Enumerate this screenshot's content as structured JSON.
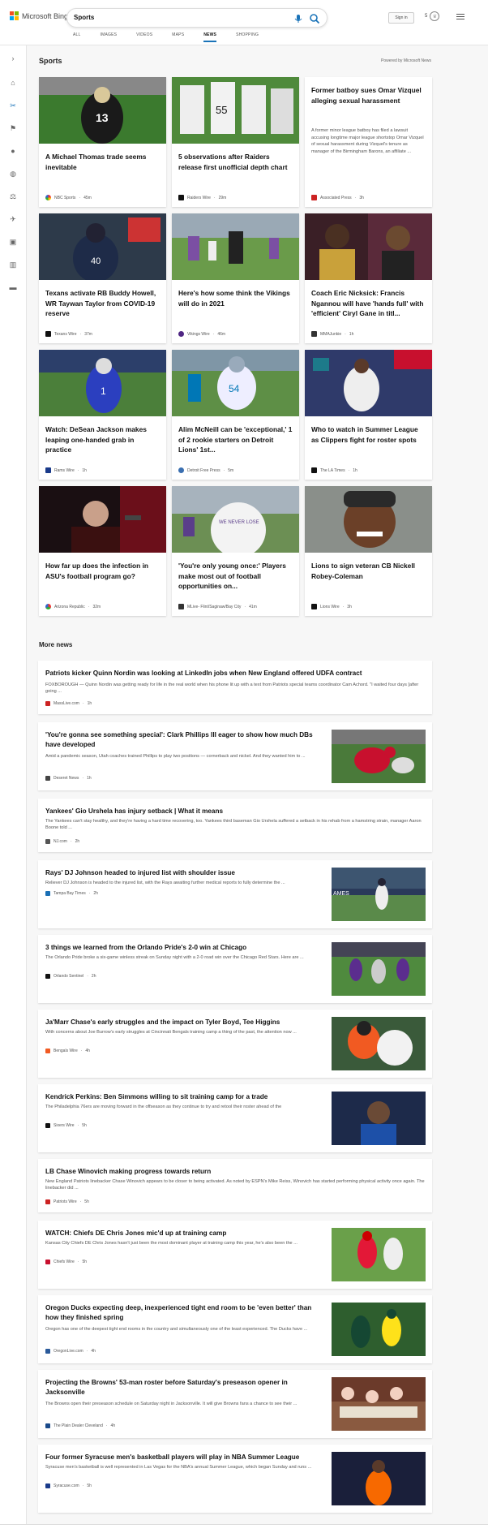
{
  "header": {
    "brand": "Microsoft Bing",
    "query": "Sports",
    "signin": "Sign in",
    "rewards_count": "5",
    "tabs": [
      "ALL",
      "IMAGES",
      "VIDEOS",
      "MAPS",
      "NEWS",
      "SHOPPING"
    ],
    "active_tab": "NEWS"
  },
  "section": {
    "title": "Sports",
    "powered": "Powered by Microsoft News"
  },
  "cards": [
    {
      "title": "A Michael Thomas trade seems inevitable",
      "source": "NBC Sports",
      "age": "45m"
    },
    {
      "title": "5 observations after Raiders release first unofficial depth chart",
      "source": "Raiders Wire",
      "age": "29m"
    },
    {
      "title": "Former batboy sues Omar Vizquel alleging sexual harassment",
      "desc": "A former minor league batboy has filed a lawsuit accusing longtime major league shortstop Omar Vizquel of sexual harassment during Vizquel's tenure as manager of the Birmingham Barons, an affiliate ...",
      "source": "Associated Press",
      "age": "3h"
    },
    {
      "title": "Texans activate RB Buddy Howell, WR Taywan Taylor from COVID-19 reserve",
      "source": "Texans Wire",
      "age": "37m"
    },
    {
      "title": "Here's how some think the Vikings will do in 2021",
      "source": "Vikings Wire",
      "age": "46m"
    },
    {
      "title": "Coach Eric Nicksick: Francis Ngannou will have 'hands full' with 'efficient' Ciryl Gane in titl...",
      "source": "MMAJunkie",
      "age": "1h"
    },
    {
      "title": "Watch: DeSean Jackson makes leaping one-handed grab in practice",
      "source": "Rams Wire",
      "age": "1h"
    },
    {
      "title": "Alim McNeill can be 'exceptional,' 1 of 2 rookie starters on Detroit Lions' 1st...",
      "source": "Detroit Free Press",
      "age": "5m"
    },
    {
      "title": "Who to watch in Summer League as Clippers fight for roster spots",
      "source": "The LA Times",
      "age": "1h"
    },
    {
      "title": "How far up does the infection in ASU's football program go?",
      "source": "Arizona Republic",
      "age": "32m"
    },
    {
      "title": "'You're only young once:' Players make most out of football opportunities on...",
      "source": "MLive- Flint/Saginaw/Bay City",
      "age": "41m"
    },
    {
      "title": "Lions to sign veteran CB Nickell Robey-Coleman",
      "source": "Lions Wire",
      "age": "3h"
    }
  ],
  "more_news_title": "More news",
  "news": [
    {
      "title": "Patriots kicker Quinn Nordin was looking at LinkedIn jobs when New England offered UDFA contract",
      "desc": "FOXBOROUGH — Quinn Nordin was getting ready for life in the real world when his phone lit up with a text from Patriots special teams coordinator Cam Achord. \"I waited four days [after going ...",
      "source": "MassLive.com",
      "age": "1h"
    },
    {
      "title": "'You're gonna see something special': Clark Phillips III eager to show how much DBs have developed",
      "desc": "Amid a pandemic season, Utah coaches trained Phillips to play two positions — cornerback and nickel. And they wanted him to ...",
      "source": "Deseret News",
      "age": "1h"
    },
    {
      "title": "Yankees' Gio Urshela has injury setback | What it means",
      "desc": "The Yankees can't stay healthy, and they're having a hard time recovering, too. Yankees third baseman Gio Urshela suffered a setback in his rehab from a hamstring strain, manager Aaron Boone told ...",
      "source": "NJ.com",
      "age": "2h"
    },
    {
      "title": "Rays' DJ Johnson headed to injured list with shoulder issue",
      "desc": "Reliever DJ Johnson is headed to the injured list, with the Rays awaiting further medical reports to fully determine the ...",
      "source": "Tampa Bay Times",
      "age": "2h"
    },
    {
      "title": "3 things we learned from the Orlando Pride's 2-0 win at Chicago",
      "desc": "The Orlando Pride broke a six-game winless streak on Sunday night with a 2-0 road win over the Chicago Red Stars. Here are ...",
      "source": "Orlando Sentinel",
      "age": "2h"
    },
    {
      "title": "Ja'Marr Chase's early struggles and the impact on Tyler Boyd, Tee Higgins",
      "desc": "With concerns about Joe Burrow's early struggles at Cincinnati Bengals training camp a thing of the past, the attention now ...",
      "source": "Bengals Wire",
      "age": "4h"
    },
    {
      "title": "Kendrick Perkins: Ben Simmons willing to sit training camp for a trade",
      "desc": "The Philadelphia 76ers are moving forward in the offseason as they continue to try and retool their roster ahead of the",
      "source": "Sixers Wire",
      "age": "5h"
    },
    {
      "title": "LB Chase Winovich making progress towards return",
      "desc": "New England Patriots linebacker Chase Winovich appears to be closer to being activated. As noted by ESPN's Mike Reiss, Winovich has started performing physical activity once again. The linebacker did ...",
      "source": "Patriots Wire",
      "age": "5h"
    },
    {
      "title": "WATCH: Chiefs DE Chris Jones mic'd up at training camp",
      "desc": "Kansas City Chiefs DE Chris Jones hasn't just been the most dominant player at training camp this year, he's also been the ...",
      "source": "Chiefs Wire",
      "age": "5h"
    },
    {
      "title": "Oregon Ducks expecting deep, inexperienced tight end room to be 'even better' than how they finished spring",
      "desc": "Oregon has one of the deepest tight end rooms in the country and simultaneously one of the least experienced. The Ducks have ...",
      "source": "OregonLive.com",
      "age": "4h"
    },
    {
      "title": "Projecting the Browns' 53-man roster before Saturday's preseason opener in Jacksonville",
      "desc": "The Browns open their preseason schedule on Saturday night in Jacksonville. It will give Browns fans a chance to see their ...",
      "source": "The Plain Dealer Cleveland",
      "age": "4h"
    },
    {
      "title": "Four former Syracuse men's basketball players will play in NBA Summer League",
      "desc": "Syracuse men's basketball is well represented in Las Vegas for the NBA's annual Summer League, which began Sunday and runs ...",
      "source": "Syracuse.com",
      "age": "5h"
    }
  ]
}
